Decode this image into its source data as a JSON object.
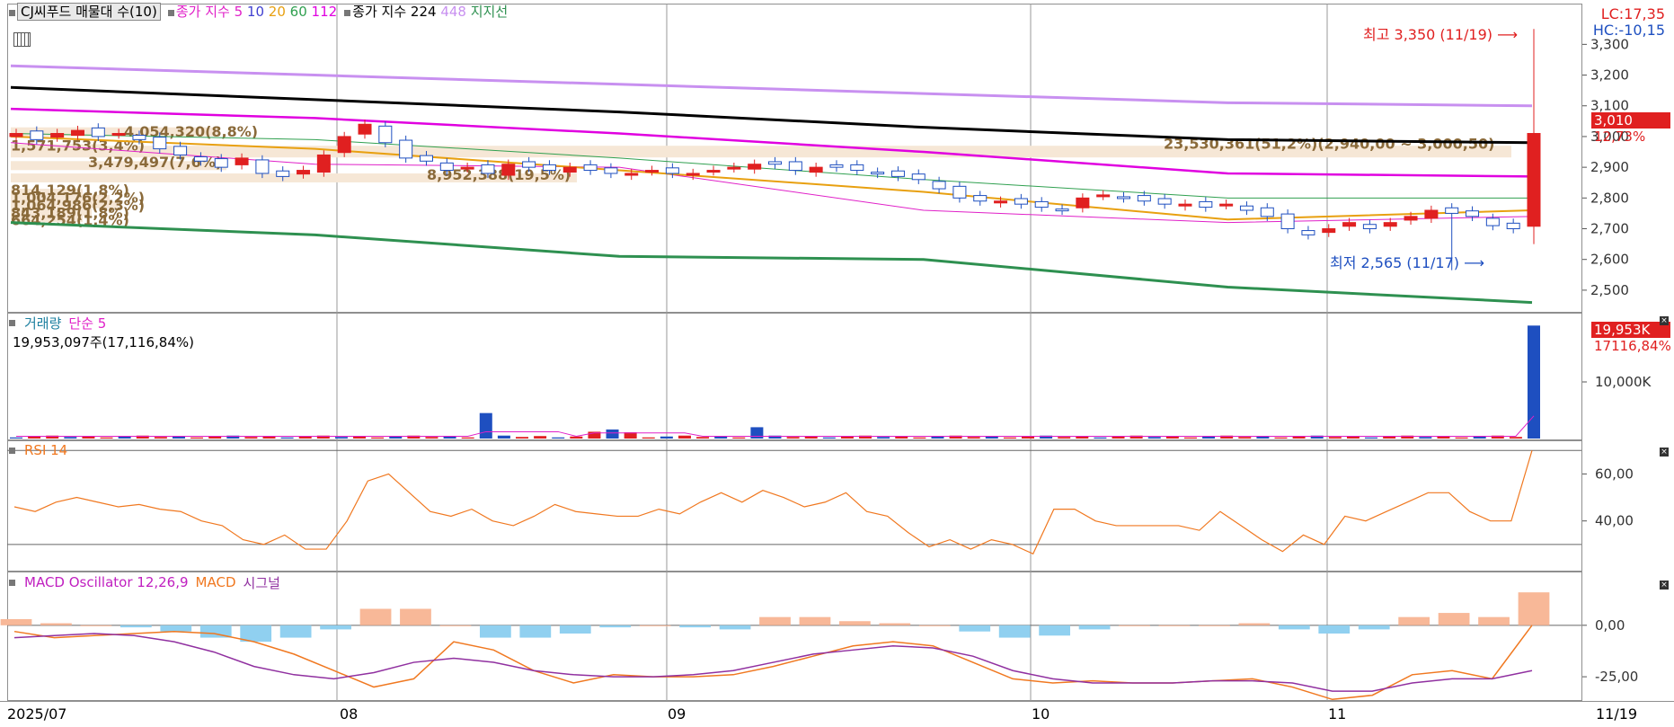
{
  "price_pane": {
    "legend": {
      "title_btn": "CJ씨푸드 매물대 수(10)",
      "ma_label": "종가 지수",
      "ma5": "5",
      "ma10": "10",
      "ma20": "20",
      "ma60": "60",
      "ma112": "112",
      "ma224_label": "종가 지수 224",
      "ma448": "448",
      "support": "지지선"
    },
    "lc": "LC:17,35",
    "hc": "HC:-10,15",
    "high_marker": "최고 3,350 (11/19)",
    "low_marker": "최저 2,565 (11/17)",
    "current_price": "3,010",
    "current_change": "12,73%",
    "volume_profile": [
      {
        "label": "23,530,361(51,2%)(2,940,00 ~ 3,000,50)"
      },
      {
        "label": "4,054,320(8,8%)"
      },
      {
        "label": "1,571,753(3,4%)"
      },
      {
        "label": "3,479,497(7,6%)"
      },
      {
        "label": "8,952,388(19,5%)"
      },
      {
        "label": "814,129(1,8%)"
      },
      {
        "label": "1,004,176(2,2%)"
      },
      {
        "label": "1,064,986(2,3%)"
      },
      {
        "label": "843,189(1,8%)"
      },
      {
        "label": "664,254(1,4%)"
      }
    ],
    "y_ticks": [
      "3,300",
      "3,200",
      "3,100",
      "3,000",
      "2,900",
      "2,800",
      "2,700",
      "2,600",
      "2,500"
    ]
  },
  "volume_pane": {
    "legend_volume": "거래량",
    "legend_ma": "단순 5",
    "info": "19,953,097주(17,116,84%)",
    "current": "19,953K",
    "current_pct": "17116,84%",
    "y_ticks": [
      "10,000K"
    ]
  },
  "rsi_pane": {
    "legend": "RSI 14",
    "y_ticks": [
      "60,00",
      "40,00"
    ]
  },
  "macd_pane": {
    "legend_osc": "MACD Oscillator 12,26,9",
    "legend_macd": "MACD",
    "legend_signal": "시그널",
    "y_ticks": [
      "0,00",
      "-25,00"
    ]
  },
  "x_axis": {
    "labels": [
      "2025/07",
      "08",
      "09",
      "10",
      "11"
    ],
    "right_label": "11/19"
  },
  "colors": {
    "up": "#e02020",
    "down": "#1e4fc0",
    "ma5": "#e020c8",
    "ma10": "#4040d0",
    "ma20": "#e8a010",
    "ma60": "#30a050",
    "ma112": "#e000e0",
    "ma224": "#000000",
    "ma448": "#c890f0",
    "support": "#2e9050",
    "rsi": "#f07820",
    "macd": "#f07820",
    "signal": "#9030a0",
    "osc_pos": "#f8b898",
    "osc_neg": "#90d0f0"
  },
  "chart_data": [
    {
      "type": "line",
      "title": "CJ씨푸드 (price, moving averages)",
      "x": [
        "2025/07",
        "08",
        "09",
        "10",
        "11",
        "11/19"
      ],
      "ylim": [
        2450,
        3380
      ],
      "series": [
        {
          "name": "종가 지수 5",
          "values": [
            2980,
            2910,
            2900,
            2760,
            2720,
            2740
          ]
        },
        {
          "name": "종가 지수 20",
          "values": [
            3000,
            2960,
            2890,
            2820,
            2730,
            2760
          ]
        },
        {
          "name": "종가 지수 60",
          "values": [
            3010,
            2990,
            2930,
            2860,
            2800,
            2800
          ]
        },
        {
          "name": "종가 지수 112",
          "values": [
            3090,
            3060,
            3010,
            2950,
            2880,
            2870
          ]
        },
        {
          "name": "종가 지수 224",
          "values": [
            3160,
            3120,
            3080,
            3030,
            2990,
            2980
          ]
        },
        {
          "name": "448",
          "values": [
            3230,
            3200,
            3170,
            3140,
            3110,
            3100
          ]
        },
        {
          "name": "지지선",
          "values": [
            2720,
            2680,
            2610,
            2600,
            2510,
            2460
          ]
        }
      ],
      "annotations": [
        {
          "label": "최고 3,350 (11/19)",
          "value": 3350
        },
        {
          "label": "최저 2,565 (11/17)",
          "value": 2565
        }
      ]
    },
    {
      "type": "bar",
      "title": "거래량",
      "values_k": [
        400,
        600,
        300,
        700,
        4500,
        1200,
        700,
        600,
        500,
        400,
        19953
      ],
      "ylim": [
        0,
        20000
      ]
    },
    {
      "type": "line",
      "title": "RSI 14",
      "ylim": [
        20,
        72
      ],
      "values": [
        46,
        44,
        48,
        50,
        48,
        46,
        47,
        45,
        44,
        40,
        38,
        32,
        30,
        34,
        28,
        28,
        40,
        57,
        60,
        52,
        44,
        42,
        45,
        40,
        38,
        42,
        47,
        44,
        43,
        42,
        42,
        45,
        43,
        48,
        52,
        48,
        53,
        50,
        46,
        48,
        52,
        44,
        42,
        35,
        29,
        32,
        28,
        32,
        30,
        26,
        45,
        45,
        40,
        38,
        38,
        38,
        38,
        36,
        44,
        38,
        32,
        27,
        34,
        30,
        42,
        40,
        44,
        48,
        52,
        52,
        44,
        40,
        40,
        70
      ]
    },
    {
      "type": "line",
      "title": "MACD Oscillator 12,26,9",
      "ylim": [
        -35,
        20
      ],
      "series": [
        {
          "name": "MACD",
          "values": [
            -3,
            -6,
            -5,
            -4,
            -3,
            -4,
            -8,
            -14,
            -22,
            -30,
            -26,
            -8,
            -12,
            -22,
            -28,
            -24,
            -25,
            -25,
            -24,
            -20,
            -15,
            -10,
            -8,
            -10,
            -18,
            -26,
            -28,
            -27,
            -28,
            -28,
            -27,
            -26,
            -30,
            -36,
            -34,
            -24,
            -22,
            -26,
            0
          ]
        },
        {
          "name": "시그널",
          "values": [
            -6,
            -5,
            -4,
            -5,
            -8,
            -13,
            -20,
            -24,
            -26,
            -23,
            -18,
            -16,
            -18,
            -22,
            -24,
            -25,
            -25,
            -24,
            -22,
            -18,
            -14,
            -12,
            -10,
            -11,
            -15,
            -22,
            -26,
            -28,
            -28,
            -28,
            -27,
            -27,
            -28,
            -32,
            -32,
            -28,
            -26,
            -26,
            -22
          ]
        },
        {
          "name": "MACD Oscillator",
          "values": [
            3,
            1,
            0,
            -1,
            -3,
            -6,
            -8,
            -6,
            -2,
            8,
            8,
            0,
            -6,
            -6,
            -4,
            -1,
            0,
            -1,
            -2,
            4,
            4,
            2,
            1,
            0,
            -3,
            -6,
            -5,
            -2,
            0,
            0,
            0,
            1,
            -2,
            -4,
            -2,
            4,
            6,
            4,
            16
          ]
        }
      ],
      "y_ticks": [
        "0,00",
        "-25,00"
      ]
    }
  ]
}
